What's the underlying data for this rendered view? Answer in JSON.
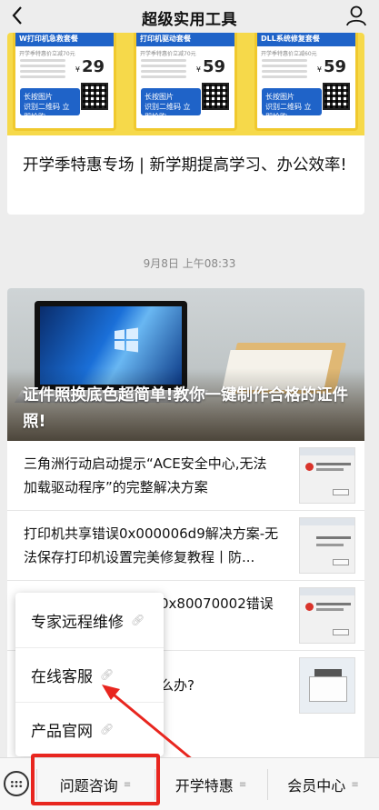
{
  "header": {
    "title": "超级实用工具",
    "back_icon": "chevron-left-icon",
    "profile_icon": "user-icon"
  },
  "promo": {
    "posters": [
      {
        "head": "W打印机急救套餐",
        "sub": "开学季特惠价立减70元",
        "price": "29",
        "cta_line1": "长按图片",
        "cta_line2": "识别二维码 立即抢购"
      },
      {
        "head": "打印机驱动套餐",
        "sub": "开学季特惠价立减70元",
        "price": "59",
        "cta_line1": "长按图片",
        "cta_line2": "识别二维码 立即抢购"
      },
      {
        "head": "DLL系统修复套餐",
        "sub": "开学季特惠价立减60元",
        "price": "59",
        "cta_line1": "长按图片",
        "cta_line2": "识别二维码 立即抢购"
      }
    ],
    "currency_symbol": "¥",
    "image_count": "5",
    "headline": "开学季特惠专场 | 新学期提高学习、办公效率!"
  },
  "timestamp": "9月8日 上午08:33",
  "cover_article": {
    "title": "证件照换底色超简单!教你一键制作合格的证件照!"
  },
  "articles": [
    {
      "title": "三角洲行动启动提示“ACE安全中心,无法加载驱动程序”的完整解决方案"
    },
    {
      "title": "打印机共享错误0x000006d9解决方案-无法保存打印机设置完美修复教程丨防..."
    },
    {
      "title": "0x80070002错误"
    },
    {
      "title": "么办?"
    }
  ],
  "menu": {
    "items": [
      "专家远程维修",
      "在线客服",
      "产品官网"
    ]
  },
  "tabbar": {
    "tabs": [
      "问题咨询",
      "开学特惠",
      "会员中心"
    ],
    "keyboard_icon": "keyboard-icon",
    "highlight_color": "#e8261f"
  }
}
